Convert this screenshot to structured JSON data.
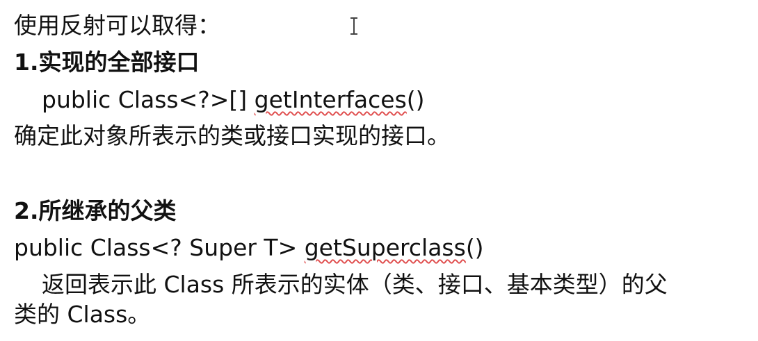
{
  "lines": {
    "intro": "使用反射可以取得：",
    "h1": "1.实现的全部接口",
    "code1_prefix": "public Class<?>[] ",
    "code1_method": "getInterfaces",
    "code1_suffix": "()",
    "desc1": "确定此对象所表示的类或接口实现的接口。",
    "h2": "2.所继承的父类",
    "code2_prefix": "public Class<? Super T> ",
    "code2_method": "getSuperclass",
    "code2_suffix": "()",
    "desc2_line1": "返回表示此 Class 所表示的实体（类、接口、基本类型）的父",
    "desc2_line2": "类的 Class。"
  },
  "colors": {
    "text": "#111111",
    "spellcheck_underline": "#e05050"
  },
  "icons": {
    "cursor": "text-cursor-icon"
  }
}
